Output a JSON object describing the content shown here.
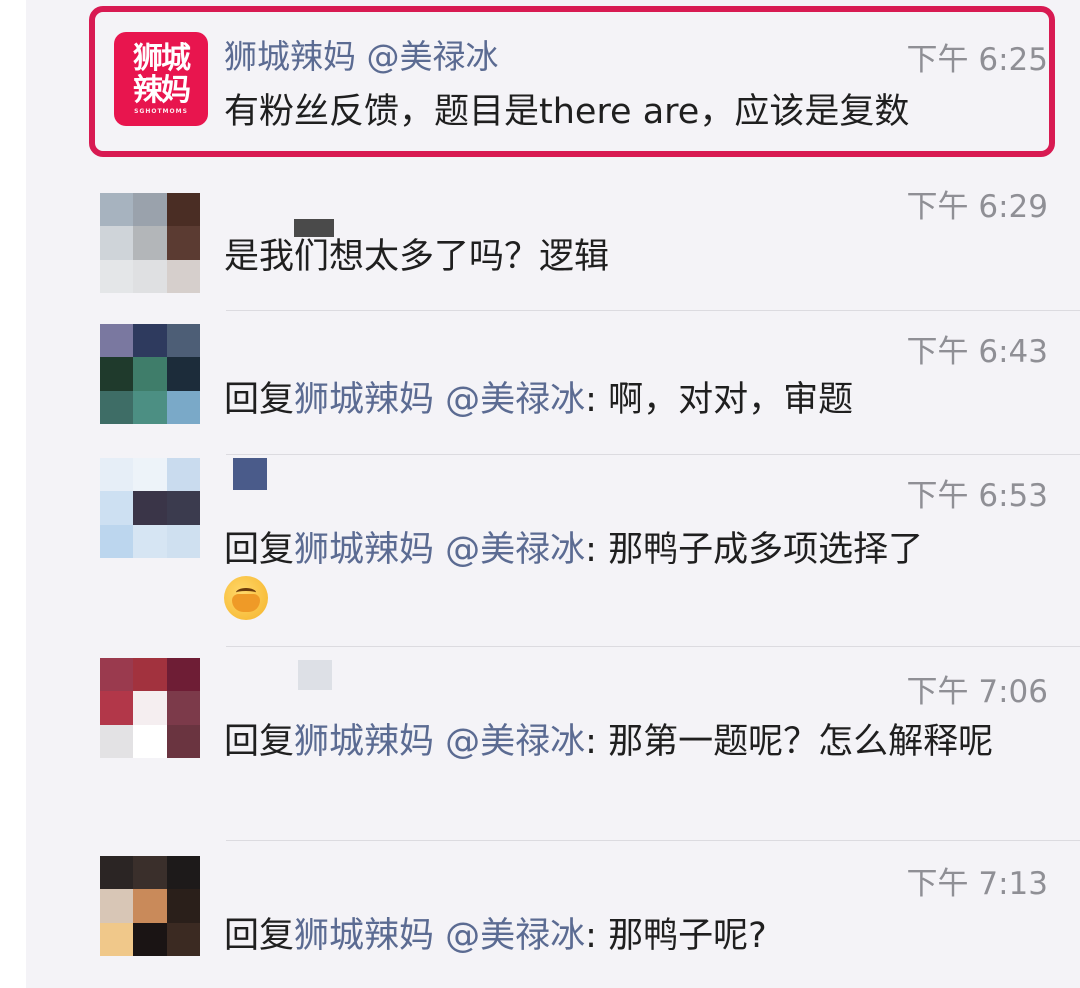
{
  "messages": [
    {
      "sender": "狮城辣妈 @美禄冰",
      "time": "下午 6:25",
      "text": "有粉丝反馈，题目是there are，应该是复数",
      "avatar_logo_line1": "狮城",
      "avatar_logo_line2": "辣妈",
      "avatar_logo_sub": "SGHOTMOMS",
      "highlighted": true
    },
    {
      "time": "下午 6:29",
      "text": "是我们想太多了吗？逻辑"
    },
    {
      "time": "下午 6:43",
      "reply_prefix": "回复",
      "reply_target": "狮城辣妈 @美禄冰",
      "text": ": 啊，对对，审题"
    },
    {
      "time": "下午 6:53",
      "reply_prefix": "回复",
      "reply_target": "狮城辣妈 @美禄冰",
      "text": ": 那鸭子成多项选择了",
      "emoji": "face-palm-emoji"
    },
    {
      "time": "下午 7:06",
      "reply_prefix": "回复",
      "reply_target": "狮城辣妈 @美禄冰",
      "text": ": 那第一题呢？怎么解释呢"
    },
    {
      "time": "下午 7:13",
      "reply_prefix": "回复",
      "reply_target": "狮城辣妈 @美禄冰",
      "text": ": 那鸭子呢?"
    }
  ],
  "colors": {
    "mention": "#5b6b92",
    "highlight_border": "#d81a52",
    "brand": "#e8154e",
    "background": "#f4f3f7"
  }
}
